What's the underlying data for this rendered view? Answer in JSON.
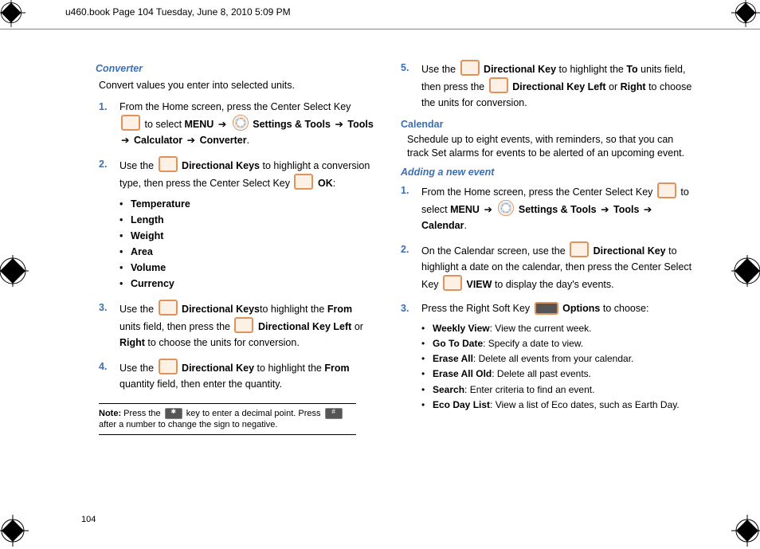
{
  "header": {
    "text": "u460.book  Page 104  Tuesday, June 8, 2010  5:09 PM"
  },
  "converter": {
    "title": "Converter",
    "intro": "Convert values you enter into selected units.",
    "step1_a": "From the Home screen, press the Center Select Key ",
    "step1_b": "to select ",
    "step1_menu": "MENU",
    "step1_settings": " Settings & Tools",
    "step1_tools": " Tools",
    "step1_calc": "Calculator",
    "step1_conv": " Converter",
    "step2_a": "Use the ",
    "step2_b": " Directional Keys",
    "step2_c": " to highlight a conversion type, then press the Center Select Key ",
    "step2_ok": " OK",
    "bullets": {
      "temperature": "Temperature",
      "length": "Length",
      "weight": "Weight",
      "area": "Area",
      "volume": "Volume",
      "currency": "Currency"
    },
    "step3_a": "Use the ",
    "step3_b": " Directional Keys",
    "step3_c": "to highlight the ",
    "step3_from": "From",
    "step3_d": " units field, then press the ",
    "step3_e": " Directional Key Left",
    "step3_or": " or ",
    "step3_right": "Right",
    "step3_f": " to choose the units for conversion.",
    "step4_a": "Use the ",
    "step4_b": " Directional Key",
    "step4_c": " to highlight the ",
    "step4_from": "From",
    "step4_d": " quantity field, then enter the quantity.",
    "note_label": "Note:",
    "note_a": " Press the ",
    "note_b": " key to enter a decimal point. Press ",
    "note_c": " after a number to change the sign to negative.",
    "step5_a": "Use the ",
    "step5_b": " Directional Key",
    "step5_c": " to highlight the ",
    "step5_to": "To",
    "step5_d": " units field, then press the ",
    "step5_e": " Directional Key Left",
    "step5_or": " or ",
    "step5_right": "Right",
    "step5_f": " to choose the units for conversion."
  },
  "calendar": {
    "title": "Calendar",
    "intro": "Schedule up to eight events, with reminders, so that you can track  Set alarms for events to be alerted of an upcoming event.",
    "adding_title": "Adding a new event",
    "step1_a": "From the Home screen, press the Center Select Key ",
    "step1_b": "to select ",
    "step1_menu": "MENU",
    "step1_settings": " Settings & Tools",
    "step1_tools": " Tools",
    "step1_cal": "Calendar",
    "step2_a": "On the Calendar screen, use the ",
    "step2_b": " Directional Key",
    "step2_c": " to highlight a date on the calendar, then press the Center Select Key ",
    "step2_view": " VIEW",
    "step2_d": " to display the day's events.",
    "step3_a": "Press the Right Soft Key ",
    "step3_options": " Options",
    "step3_b": " to choose:",
    "bullets": {
      "weekly_b": "Weekly View",
      "weekly_t": ": View the current week.",
      "goto_b": "Go To Date",
      "goto_t": ": Specify a date to view.",
      "eraseall_b": "Erase All",
      "eraseall_t": ": Delete all events from your calendar.",
      "eraseold_b": "Erase All Old",
      "eraseold_t": ": Delete all past events.",
      "search_b": "Search",
      "search_t": ": Enter criteria to find an event.",
      "eco_b": "Eco Day List",
      "eco_t": ": View a list of Eco dates, such as Earth Day."
    }
  },
  "pagenum": "104",
  "nums": {
    "n1": "1.",
    "n2": "2.",
    "n3": "3.",
    "n4": "4.",
    "n5": "5."
  },
  "arrow": "➔"
}
